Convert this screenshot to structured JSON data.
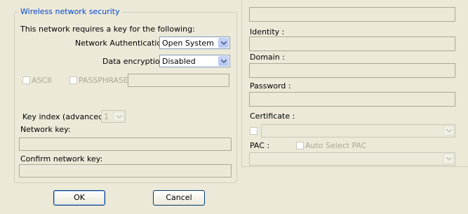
{
  "security": {
    "group_title": "Wireless network security",
    "requirement_text": "This network requires a key for the following:",
    "auth_label": "Network Authentication:",
    "auth_value": "Open System",
    "encryption_label": "Data encryption:",
    "encryption_value": "Disabled",
    "ascii_label": "ASCII",
    "passphrase_label": "PASSPHRASE",
    "key_index_label": "Key index (advanced):",
    "key_index_value": "1",
    "network_key_label": "Network key:",
    "confirm_key_label": "Confirm network key:"
  },
  "eap": {
    "identity_label": "Identity :",
    "domain_label": "Domain :",
    "password_label": "Password :",
    "certificate_label": "Certificate :",
    "pac_label": "PAC :",
    "auto_select_pac_label": "Auto Select PAC"
  },
  "buttons": {
    "ok": "OK",
    "cancel": "Cancel"
  },
  "icons": {
    "dropdown": "chevron-down-icon"
  },
  "colors": {
    "group_title": "#0046d5",
    "disabled_text": "#aca899",
    "dialog_bg": "#ece9d8"
  }
}
